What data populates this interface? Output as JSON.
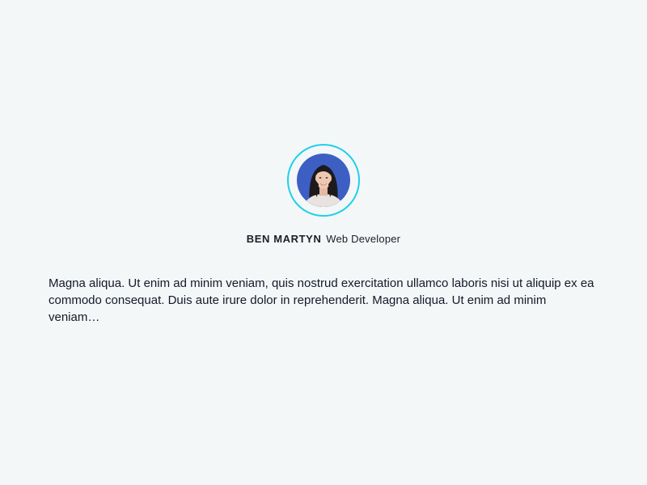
{
  "testimonial": {
    "author_name": "BEN MARTYN",
    "author_role": "Web Developer",
    "quote": "Magna aliqua. Ut enim ad minim veniam, quis nostrud exercitation ullamco laboris nisi ut aliquip ex ea commodo consequat. Duis aute irure dolor in reprehenderit. Magna aliqua. Ut enim ad minim veniam…"
  },
  "icons": {
    "avatar": "user-avatar-photo"
  },
  "colors": {
    "background": "#f4f7f8",
    "avatar_ring": "#1fd0ea",
    "avatar_bg": "#3d5fc4",
    "text": "#1a1f2b"
  }
}
